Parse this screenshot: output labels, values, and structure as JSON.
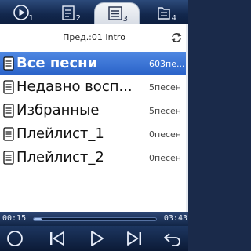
{
  "tabs": [
    {
      "icon": "play-circle-icon",
      "number": "1",
      "active": false
    },
    {
      "icon": "note-list-icon",
      "number": "2",
      "active": false
    },
    {
      "icon": "list-icon",
      "number": "3",
      "active": true
    },
    {
      "icon": "folder-list-icon",
      "number": "4",
      "active": false
    }
  ],
  "header": {
    "title": "Пред.:01 Intro",
    "repeat_icon": "repeat-icon"
  },
  "list": [
    {
      "label": "Все песни",
      "count": "603пе...",
      "selected": true
    },
    {
      "label": "Недавно восп...",
      "count": "5песен",
      "selected": false
    },
    {
      "label": "Избранные",
      "count": "5песен",
      "selected": false
    },
    {
      "label": "Плейлист_1",
      "count": "0песен",
      "selected": false
    },
    {
      "label": "Плейлист_2",
      "count": "0песен",
      "selected": false
    }
  ],
  "player": {
    "current_time": "00:15",
    "total_time": "03:43",
    "progress_fraction": 0.067
  },
  "controls": {
    "settings": "options-circle-icon",
    "previous": "previous-track-icon",
    "play": "play-icon",
    "next": "next-track-icon",
    "back": "back-arrow-icon"
  },
  "colors": {
    "selection": "#3a72d6",
    "bar_dark": "#13284e"
  }
}
